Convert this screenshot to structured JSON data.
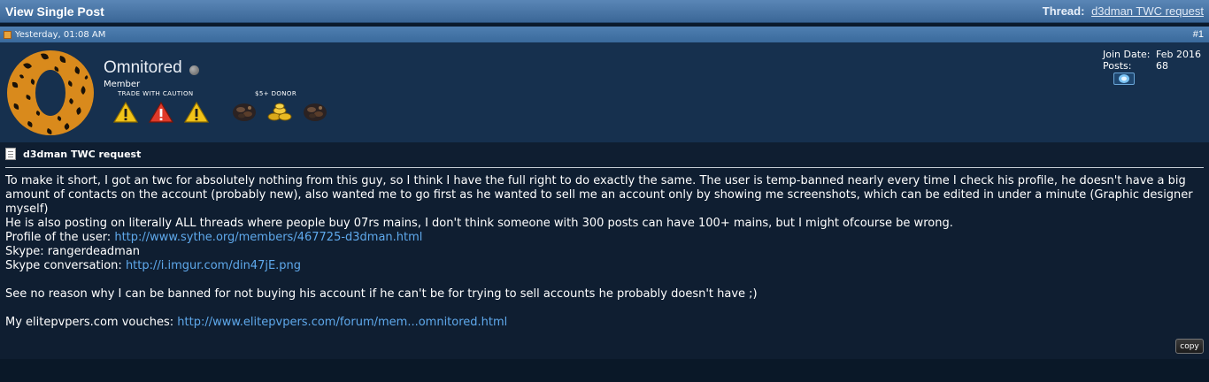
{
  "titlebar": {
    "title": "View Single Post",
    "thread_label": "Thread:",
    "thread_link": "d3dman TWC request"
  },
  "postbar": {
    "date": "Yesterday, 01:08 AM",
    "post_number": "#1"
  },
  "user": {
    "name": "Omnitored",
    "title": "Member",
    "award_caption_1": "TRADE WITH CAUTION",
    "award_caption_2": "$5+ DONOR",
    "join_date_label": "Join Date:",
    "join_date": "Feb 2016",
    "posts_label": "Posts:",
    "posts": "68"
  },
  "post": {
    "title": "d3dman TWC request",
    "line1": "To make it short, I got an twc for absolutely nothing from this guy, so I think I have the full right to do exactly the same. The user is temp-banned nearly every time I check his profile, he doesn't have a big amount of contacts on the account (probably new), also wanted me to go first as he wanted to sell me an account only by showing me screenshots, which can be edited in under a minute (Graphic designer myself)",
    "line2": "He is also posting on literally ALL threads where people buy 07rs mains, I don't think someone with 300 posts can have 100+ mains, but I might ofcourse be wrong.",
    "profile_label": "Profile of the user:",
    "profile_link": "http://www.sythe.org/members/467725-d3dman.html",
    "skype_line": "Skype: rangerdeadman",
    "skype_conv_label": "Skype conversation:",
    "skype_conv_link": "http://i.imgur.com/din47jE.png",
    "line3": "See no reason why I can be banned for not buying his account if he can't be for trying to sell accounts he probably doesn't have ;)",
    "vouch_label": "My elitepvpers.com vouches:",
    "vouch_link": "http://www.elitepvpers.com/forum/mem...omnitored.html"
  },
  "copy_button": "copy"
}
